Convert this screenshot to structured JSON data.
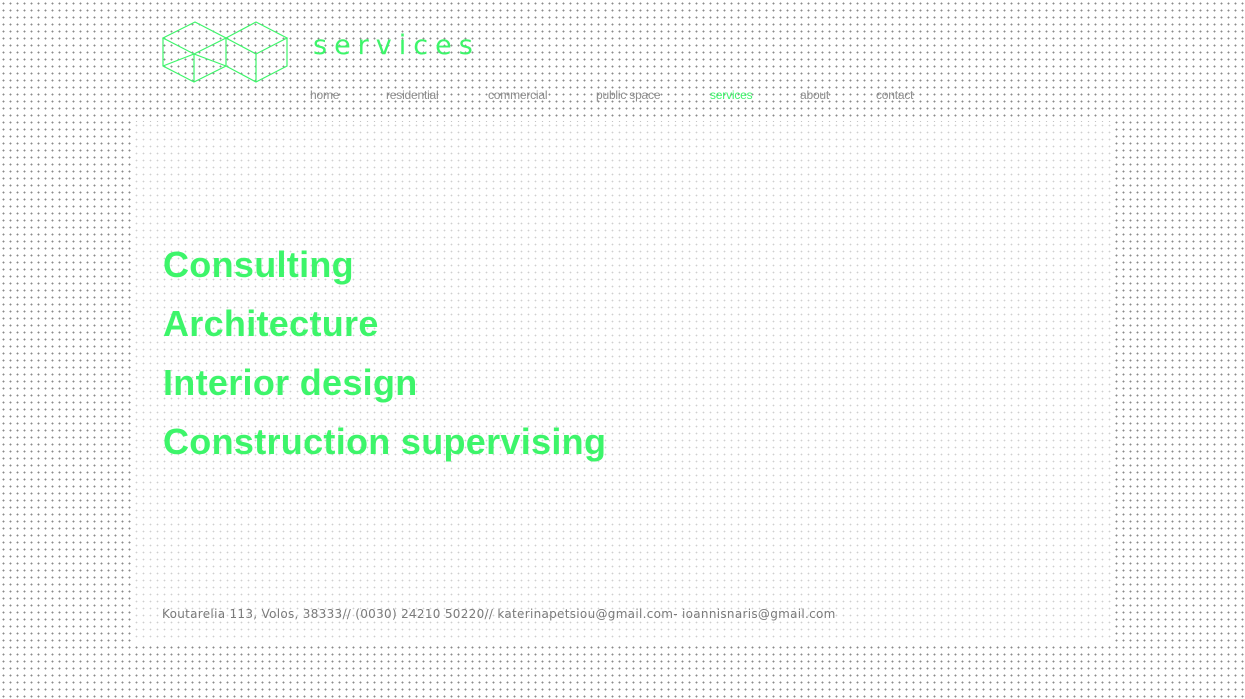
{
  "header": {
    "title": "services"
  },
  "nav": {
    "items": [
      {
        "label": "home"
      },
      {
        "label": "residential"
      },
      {
        "label": "commercial"
      },
      {
        "label": "public space"
      },
      {
        "label": "services",
        "active": true
      },
      {
        "label": "about"
      },
      {
        "label": "contact"
      }
    ]
  },
  "main": {
    "services": [
      "Consulting",
      "Architecture",
      "Interior design",
      "Construction supervising"
    ]
  },
  "footer": {
    "contact_line": "Koutarelia 113, Volos, 38333// (0030) 24210 50220// katerinapetsiou@gmail.com- ioannisnaris@gmail.com"
  },
  "colors": {
    "accent": "#3df56a",
    "nav_text": "#8c8c8c",
    "footer_text": "#7a7a7a"
  },
  "icons": {
    "logo": "cubes-logo-icon"
  }
}
